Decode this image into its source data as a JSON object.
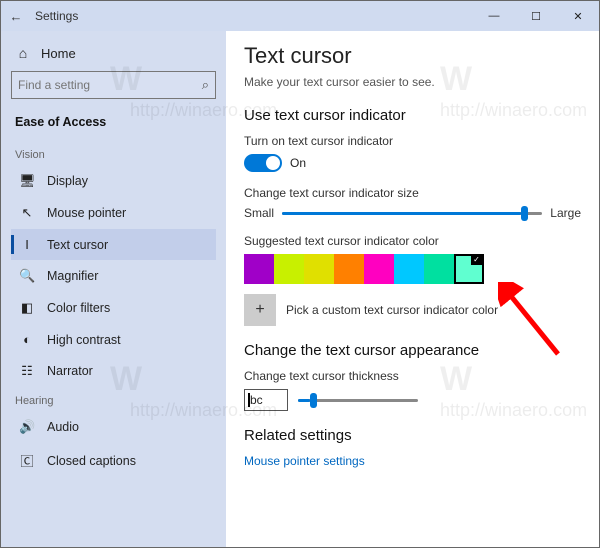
{
  "titlebar": {
    "title": "Settings",
    "back_icon": "←",
    "min": "—",
    "max": "☐",
    "close": "✕"
  },
  "sidebar": {
    "home_icon": "⌂",
    "home_label": "Home",
    "search_placeholder": "Find a setting",
    "section": "Ease of Access",
    "groups": [
      {
        "label": "Vision",
        "items": [
          {
            "icon": "🖥",
            "label": "Display"
          },
          {
            "icon": "↖",
            "label": "Mouse pointer"
          },
          {
            "icon": "I",
            "label": "Text cursor",
            "selected": true
          },
          {
            "icon": "🔍",
            "label": "Magnifier"
          },
          {
            "icon": "◧",
            "label": "Color filters"
          },
          {
            "icon": "◐",
            "label": "High contrast"
          },
          {
            "icon": "☷",
            "label": "Narrator"
          }
        ]
      },
      {
        "label": "Hearing",
        "items": [
          {
            "icon": "🔊",
            "label": "Audio"
          },
          {
            "icon": "🄲",
            "label": "Closed captions"
          }
        ]
      }
    ]
  },
  "content": {
    "title": "Text cursor",
    "subtitle": "Make your text cursor easier to see.",
    "indicator": {
      "heading": "Use text cursor indicator",
      "toggle_label": "Turn on text cursor indicator",
      "toggle_state": "On",
      "size_label": "Change text cursor indicator size",
      "size_small": "Small",
      "size_large": "Large",
      "size_value_pct": 92,
      "color_label": "Suggested text cursor indicator color",
      "swatches": [
        "#a000c8",
        "#c8f000",
        "#e0e000",
        "#ff8000",
        "#ff00c0",
        "#00c8ff",
        "#00e0a0",
        "#60ffd0"
      ],
      "selected_swatch_index": 7,
      "custom_label": "Pick a custom text cursor indicator color",
      "plus": "+"
    },
    "appearance": {
      "heading": "Change the text cursor appearance",
      "thickness_label": "Change text cursor thickness",
      "preview_text": "bc"
    },
    "related": {
      "heading": "Related settings",
      "link": "Mouse pointer settings"
    }
  },
  "watermark": {
    "text": "http://winaero.com",
    "logo": "W"
  }
}
